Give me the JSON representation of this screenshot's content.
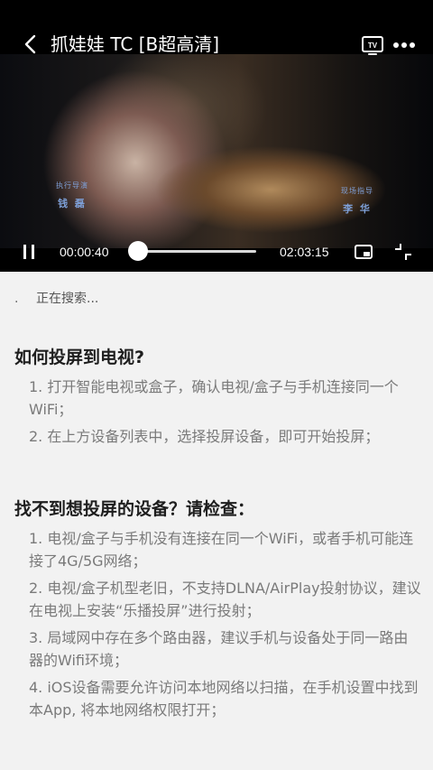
{
  "header": {
    "title": "抓娃娃 TC [B超高清]",
    "back_icon": "chevron-left-icon",
    "tv_icon": "tv-icon",
    "more_icon": "more-horizontal-icon"
  },
  "video": {
    "credit_left_role": "执行导演",
    "credit_left_name": "钱 磊",
    "credit_right_role": "现场指导",
    "credit_right_name": "李 华"
  },
  "player": {
    "current_time": "00:00:40",
    "total_time": "02:03:15",
    "progress": 0.005,
    "pause_icon": "pause-icon",
    "pip_icon": "picture-in-picture-icon",
    "fullscreen_icon": "fullscreen-exit-icon"
  },
  "search": {
    "dot": ".",
    "status": "正在搜索..."
  },
  "section1": {
    "title": "如何投屏到电视?",
    "items": [
      "1. 打开智能电视或盒子，确认电视/盒子与手机连接同一个WiFi；",
      "2. 在上方设备列表中，选择投屏设备，即可开始投屏；"
    ]
  },
  "section2": {
    "title": "找不到想投屏的设备？请检查：",
    "items": [
      "1. 电视/盒子与手机没有连接在同一个WiFi，或者手机可能连接了4G/5G网络；",
      "2. 电视/盒子机型老旧，不支持DLNA/AirPlay投射协议，建议在电视上安装“乐播投屏”进行投射；",
      "3. 局域网中存在多个路由器，建议手机与设备处于同一路由器的Wifi环境；",
      "4. iOS设备需要允许访问本地网络以扫描，在手机设置中找到本App, 将本地网络权限打开；"
    ]
  },
  "colors": {
    "player_bg": "#000000",
    "page_bg": "#f2f2f2",
    "title_text": "#1e1e1e",
    "tip_text": "#7a7a7a"
  }
}
